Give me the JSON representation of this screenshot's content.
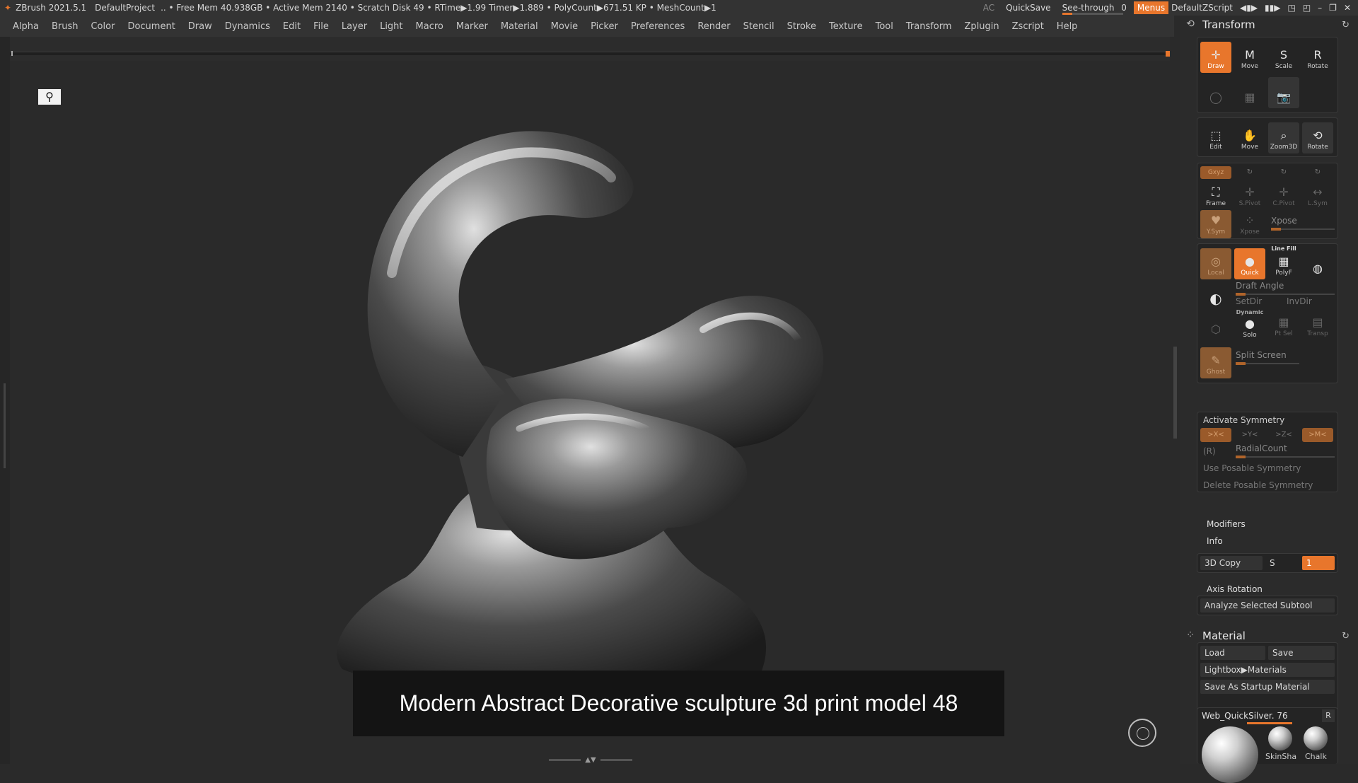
{
  "titlebar": {
    "app": "ZBrush 2021.5.1",
    "project": "DefaultProject",
    "stats": ".. • Free Mem 40.938GB • Active Mem 2140 • Scratch Disk 49 • RTime▶1.99 Timer▶1.889 • PolyCount▶671.51 KP • MeshCount▶1",
    "ac": "AC",
    "quicksave": "QuickSave",
    "seethrough_label": "See-through",
    "seethrough_value": "0",
    "seethrough_level": 0,
    "menus": "Menus",
    "script": "DefaultZScript"
  },
  "menubar": [
    "Alpha",
    "Brush",
    "Color",
    "Document",
    "Draw",
    "Dynamics",
    "Edit",
    "File",
    "Layer",
    "Light",
    "Macro",
    "Marker",
    "Material",
    "Movie",
    "Picker",
    "Preferences",
    "Render",
    "Stencil",
    "Stroke",
    "Texture",
    "Tool",
    "Transform",
    "Zplugin",
    "Zscript",
    "Help"
  ],
  "viewport": {
    "caption": "Modern Abstract Decorative sculpture 3d print model 48"
  },
  "transform": {
    "title": "Transform",
    "draw_buttons": [
      {
        "label": "Draw",
        "glyph": "✛"
      },
      {
        "label": "Move",
        "glyph": "M"
      },
      {
        "label": "Scale",
        "glyph": "S"
      },
      {
        "label": "Rotate",
        "glyph": "R"
      }
    ],
    "nav_buttons": [
      {
        "label": "Edit",
        "glyph": "⬚"
      },
      {
        "label": "Move",
        "glyph": "✋"
      },
      {
        "label": "Zoom3D",
        "glyph": "⌕"
      },
      {
        "label": "Rotate",
        "glyph": "⟲"
      }
    ],
    "xyz": "Gxyz",
    "frame": "Frame",
    "spivot": "S.Pivot",
    "cpivot": "C.Pivot",
    "lsym": "L.Sym",
    "vsym": "Y.Sym",
    "xpose_btn": "Xpose",
    "xpose_label": "Xpose",
    "local": "Local",
    "quick": "Quick",
    "line_fill": "Line Fill",
    "polyf": "PolyF",
    "draft_angle": "Draft Angle",
    "setdir": "SetDir",
    "invdir": "InvDir",
    "dynamic": "Dynamic",
    "solo": "Solo",
    "ptsel": "Pt Sel",
    "transp": "Transp",
    "split_screen": "Split Screen",
    "ghost": "Ghost",
    "activate_symmetry": "Activate Symmetry",
    "sym_x": ">X<",
    "sym_y": ">Y<",
    "sym_z": ">Z<",
    "sym_m": ">M<",
    "r": "(R)",
    "radial_count": "RadialCount",
    "use_posable": "Use Posable Symmetry",
    "delete_posable": "Delete Posable Symmetry",
    "modifiers": "Modifiers",
    "info": "Info",
    "copy3d": "3D Copy",
    "s": "S",
    "copy_val": "1",
    "axis_rotation": "Axis Rotation",
    "analyze": "Analyze Selected Subtool"
  },
  "material": {
    "title": "Material",
    "load": "Load",
    "save": "Save",
    "lightbox": "Lightbox▶Materials",
    "save_startup": "Save As Startup Material",
    "current": "Web_QuickSilver. 76",
    "r": "R",
    "swatch1": "SkinSha",
    "swatch2": "Chalk"
  },
  "colors": {
    "accent": "#e8762c",
    "panel": "#2b2b2b",
    "viewport": "#2a2a2a"
  }
}
